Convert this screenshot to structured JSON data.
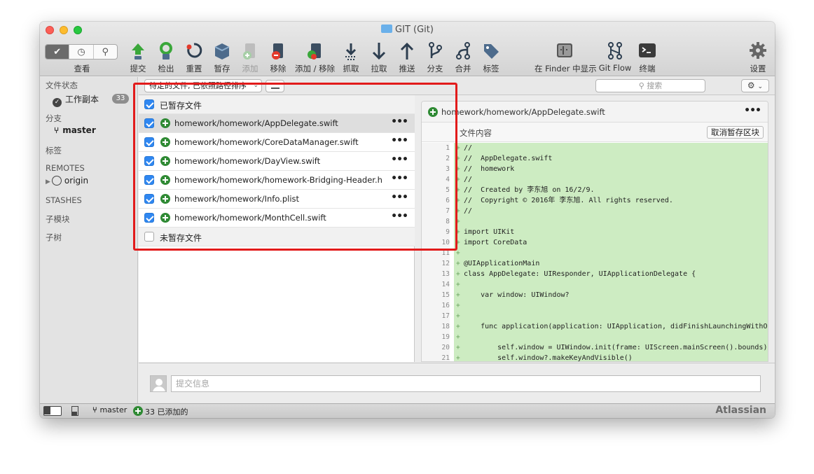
{
  "window": {
    "title": "GIT (Git)",
    "icon": "folder-icon"
  },
  "toolbar": {
    "view_label": "查看",
    "view_segments": [
      "check-icon",
      "clock-icon",
      "search-icon"
    ],
    "buttons": [
      {
        "label": "提交",
        "icon": "commit-icon"
      },
      {
        "label": "检出",
        "icon": "checkout-icon"
      },
      {
        "label": "重置",
        "icon": "reset-icon"
      },
      {
        "label": "暂存",
        "icon": "stash-icon"
      },
      {
        "label": "添加",
        "icon": "add-icon"
      },
      {
        "label": "移除",
        "icon": "remove-icon"
      },
      {
        "label": "添加 / 移除",
        "icon": "add-remove-icon"
      },
      {
        "label": "抓取",
        "icon": "fetch-icon"
      },
      {
        "label": "拉取",
        "icon": "pull-icon"
      },
      {
        "label": "推送",
        "icon": "push-icon"
      },
      {
        "label": "分支",
        "icon": "branch-icon"
      },
      {
        "label": "合并",
        "icon": "merge-icon"
      },
      {
        "label": "标签",
        "icon": "tag-icon"
      },
      {
        "label": "在 Finder 中显示",
        "icon": "finder-icon"
      },
      {
        "label": "Git Flow",
        "icon": "gitflow-icon"
      },
      {
        "label": "终端",
        "icon": "terminal-icon"
      },
      {
        "label": "设置",
        "icon": "settings-gear-icon"
      }
    ]
  },
  "sidebar": {
    "file_status_header": "文件状态",
    "working_copy": "工作副本",
    "working_copy_count": "33",
    "branches_header": "分支",
    "branch_master": "master",
    "tags_header": "标签",
    "remotes_header": "REMOTES",
    "remote_origin": "origin",
    "stashes_header": "STASHES",
    "submodules_header": "子模块",
    "subtrees_header": "子树"
  },
  "filter": {
    "sort_select": "待定的文件, 已依照路径排序",
    "search_placeholder": "搜索"
  },
  "files": {
    "staged_label": "已暂存文件",
    "unstaged_label": "未暂存文件",
    "items": [
      {
        "path": "homework/homework/AppDelegate.swift"
      },
      {
        "path": "homework/homework/CoreDataManager.swift"
      },
      {
        "path": "homework/homework/DayView.swift"
      },
      {
        "path": "homework/homework/homework-Bridging-Header.h"
      },
      {
        "path": "homework/homework/Info.plist"
      },
      {
        "path": "homework/homework/MonthCell.swift"
      }
    ]
  },
  "diff": {
    "file_path": "homework/homework/AppDelegate.swift",
    "hunk_title": "文件内容",
    "unstage_hunk_label": "取消暂存区块",
    "lines": [
      {
        "n": "1",
        "text": "//"
      },
      {
        "n": "2",
        "text": "//  AppDelegate.swift"
      },
      {
        "n": "3",
        "text": "//  homework"
      },
      {
        "n": "4",
        "text": "//"
      },
      {
        "n": "5",
        "text": "//  Created by 李东旭 on 16/2/9."
      },
      {
        "n": "6",
        "text": "//  Copyright © 2016年 李东旭. All rights reserved."
      },
      {
        "n": "7",
        "text": "//"
      },
      {
        "n": "8",
        "text": ""
      },
      {
        "n": "9",
        "text": "import UIKit"
      },
      {
        "n": "10",
        "text": "import CoreData"
      },
      {
        "n": "11",
        "text": ""
      },
      {
        "n": "12",
        "text": "@UIApplicationMain"
      },
      {
        "n": "13",
        "text": "class AppDelegate: UIResponder, UIApplicationDelegate {"
      },
      {
        "n": "14",
        "text": ""
      },
      {
        "n": "15",
        "text": "    var window: UIWindow?"
      },
      {
        "n": "16",
        "text": ""
      },
      {
        "n": "17",
        "text": ""
      },
      {
        "n": "18",
        "text": "    func application(application: UIApplication, didFinishLaunchingWithO"
      },
      {
        "n": "19",
        "text": ""
      },
      {
        "n": "20",
        "text": "        self.window = UIWindow.init(frame: UIScreen.mainScreen().bounds)"
      },
      {
        "n": "21",
        "text": "        self.window?.makeKeyAndVisible()"
      }
    ]
  },
  "commit": {
    "placeholder": "提交信息"
  },
  "statusbar": {
    "branch": "master",
    "added_text": "33 已添加的",
    "brand": "Atlassian"
  },
  "colors": {
    "accent": "#2f87f1",
    "added": "#2f8a34",
    "diff_bg": "#cdecc2",
    "highlight": "#e21b1b"
  }
}
